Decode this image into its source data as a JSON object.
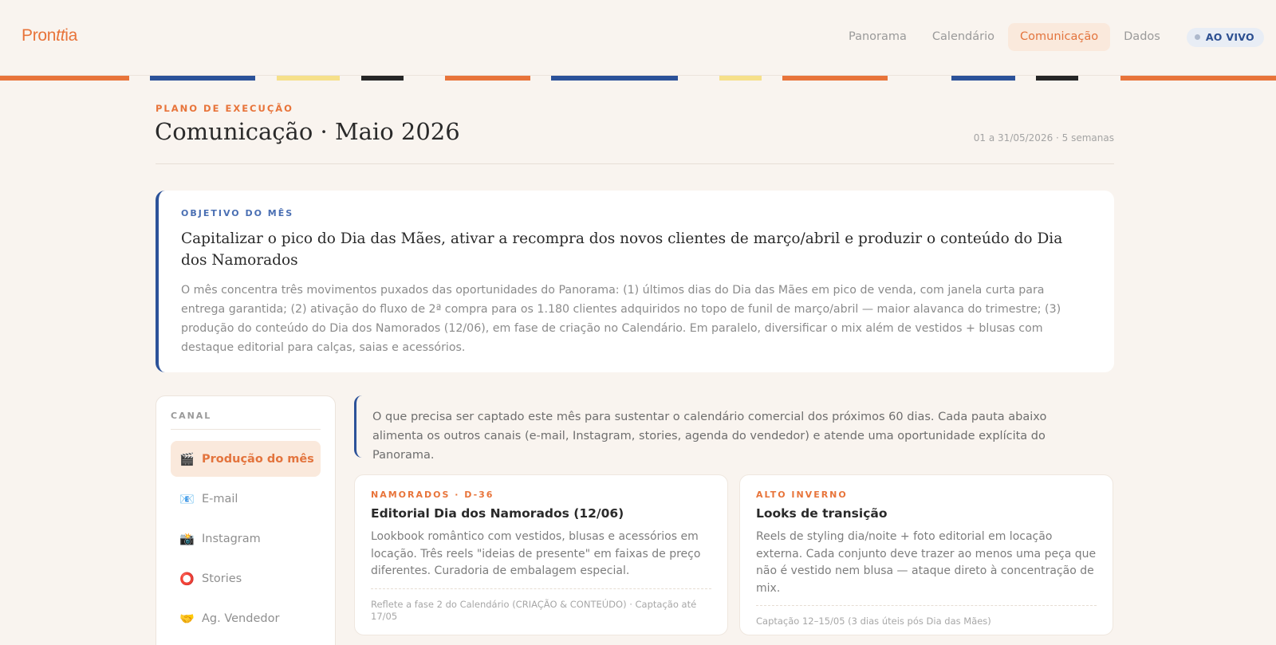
{
  "app": {
    "logo_prefix": "Pron",
    "logo_italic": "tt",
    "logo_suffix": "ia"
  },
  "nav": {
    "items": [
      {
        "label": "Panorama"
      },
      {
        "label": "Calendário"
      },
      {
        "label": "Comunicação"
      },
      {
        "label": "Dados"
      }
    ],
    "live_label": "AO VIVO"
  },
  "colors": {
    "accent": "#e8743a",
    "blue": "#2c5299",
    "yellow": "#f6e08a",
    "dark": "#262626"
  },
  "header": {
    "eyebrow": "PLANO DE EXECUÇÃO",
    "title": "Comunicação · Maio 2026",
    "meta": "01 a 31/05/2026 · 5 semanas"
  },
  "objective": {
    "eyebrow": "OBJETIVO DO MÊS",
    "title": "Capitalizar o pico do Dia das Mães, ativar a recompra dos novos clientes de março/abril e produzir o conteúdo do Dia dos Namorados",
    "body": "O mês concentra três movimentos puxados das oportunidades do Panorama: (1) últimos dias do Dia das Mães em pico de venda, com janela curta para entrega garantida; (2) ativação do fluxo de 2ª compra para os 1.180 clientes adquiridos no topo de funil de março/abril — maior alavanca do trimestre; (3) produção do conteúdo do Dia dos Namorados (12/06), em fase de criação no Calendário. Em paralelo, diversificar o mix além de vestidos + blusas com destaque editorial para calças, saias e acessórios."
  },
  "sidebar": {
    "heading": "CANAL",
    "items": [
      {
        "icon": "🎬",
        "label": "Produção do mês"
      },
      {
        "icon": "📧",
        "label": "E-mail"
      },
      {
        "icon": "📸",
        "label": "Instagram"
      },
      {
        "icon": "⭕",
        "label": "Stories"
      },
      {
        "icon": "🤝",
        "label": "Ag. Vendedor"
      }
    ]
  },
  "intro": {
    "text": "O que precisa ser captado este mês para sustentar o calendário comercial dos próximos 60 dias. Cada pauta abaixo alimenta os outros canais (e-mail, Instagram, stories, agenda do vendedor) e atende uma oportunidade explícita do Panorama."
  },
  "cards": [
    {
      "eyebrow": "NAMORADOS · D-36",
      "title": "Editorial Dia dos Namorados (12/06)",
      "body": "Lookbook romântico com vestidos, blusas e acessórios em locação. Três reels \"ideias de presente\" em faixas de preço diferentes. Curadoria de embalagem especial.",
      "foot": "Reflete a fase 2 do Calendário (CRIAÇÃO & CONTEÚDO) · Captação até 17/05"
    },
    {
      "eyebrow": "ALTO INVERNO",
      "title": "Looks de transição",
      "body": "Reels de styling dia/noite + foto editorial em locação externa. Cada conjunto deve trazer ao menos uma peça que não é vestido nem blusa — ataque direto à concentração de mix.",
      "foot": "Captação 12–15/05 (3 dias úteis pós Dia das Mães)"
    }
  ]
}
